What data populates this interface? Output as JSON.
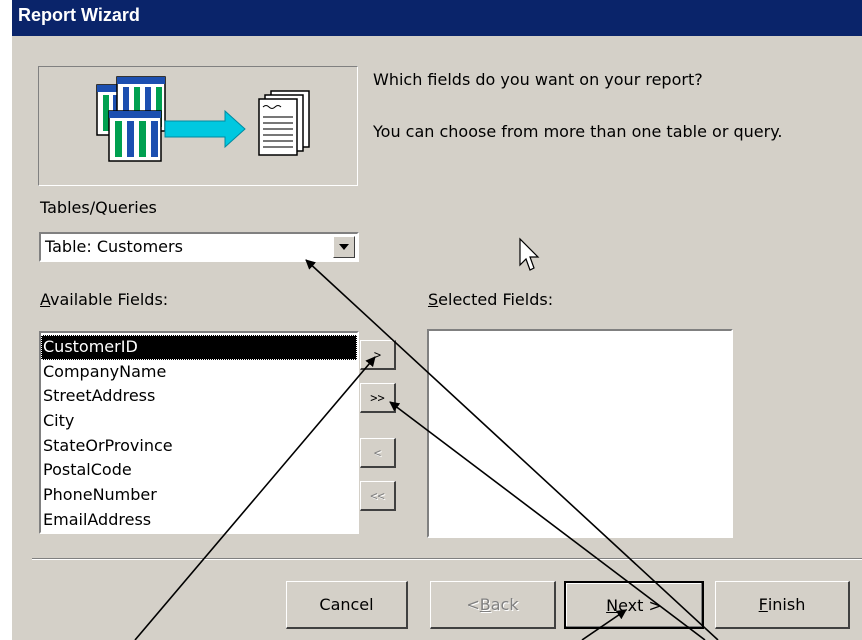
{
  "window": {
    "title": "Report Wizard"
  },
  "intro": {
    "question": "Which fields do you want on your report?",
    "hint": "You can choose from more than one table or query."
  },
  "tables_queries": {
    "label": "Tables/Queries",
    "selected": "Table: Customers"
  },
  "available_fields": {
    "label_first": "A",
    "label_rest": "vailable Fields:",
    "items": [
      "CustomerID",
      "CompanyName",
      "StreetAddress",
      "City",
      "StateOrProvince",
      "PostalCode",
      "PhoneNumber",
      "EmailAddress"
    ],
    "selected_index": 0
  },
  "selected_fields": {
    "label_first": "S",
    "label_rest": "elected Fields:",
    "items": []
  },
  "move_buttons": {
    "add_one": ">",
    "add_all": ">>",
    "remove_one": "<",
    "remove_all": "<<"
  },
  "footer": {
    "cancel": "Cancel",
    "back_pre": "< ",
    "back_key": "B",
    "back_rest": "ack",
    "next_key": "N",
    "next_rest": "ext >",
    "finish_key": "F",
    "finish_rest": "inish"
  },
  "colors": {
    "titlebar": "#0a246a",
    "face": "#d4d0c8",
    "illustration_arrow": "#00c8e0"
  }
}
